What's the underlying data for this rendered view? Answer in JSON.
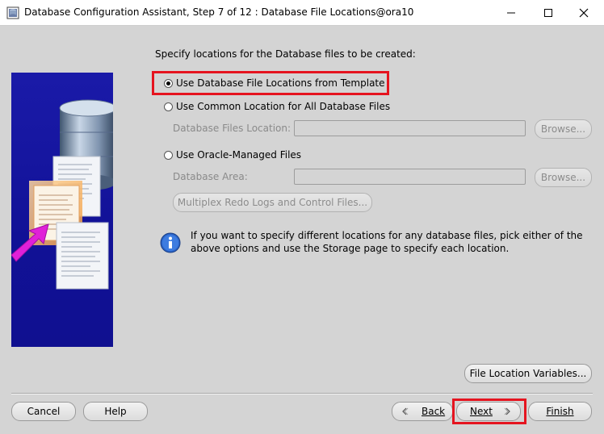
{
  "window": {
    "title": "Database Configuration Assistant, Step 7 of 12 : Database File Locations@ora10"
  },
  "main": {
    "heading": "Specify locations for the Database files to be created:",
    "options": [
      {
        "label": "Use Database File Locations from Template",
        "selected": true
      },
      {
        "label": "Use Common Location for All Database Files",
        "selected": false
      },
      {
        "label": "Use Oracle-Managed Files",
        "selected": false
      }
    ],
    "common_location": {
      "label": "Database Files Location:",
      "value": "",
      "browse_label": "Browse..."
    },
    "managed": {
      "area_label": "Database Area:",
      "area_value": "",
      "browse_label": "Browse...",
      "multiplex_label": "Multiplex Redo Logs and Control Files..."
    },
    "info_text": "If you want to specify different locations for any database files, pick either of the above options and use the Storage page to specify each location.",
    "file_location_variables_label": "File Location Variables..."
  },
  "footer": {
    "cancel_label": "Cancel",
    "help_label": "Help",
    "back_label": "Back",
    "next_label": "Next",
    "finish_label": "Finish"
  },
  "colors": {
    "highlight": "#e5141f",
    "banner": "#1414a0",
    "window_bg": "#d4d4d4"
  },
  "icons": [
    "app-icon",
    "minimize-icon",
    "maximize-icon",
    "close-icon",
    "info-icon",
    "back-arrow-icon",
    "next-arrow-icon"
  ]
}
